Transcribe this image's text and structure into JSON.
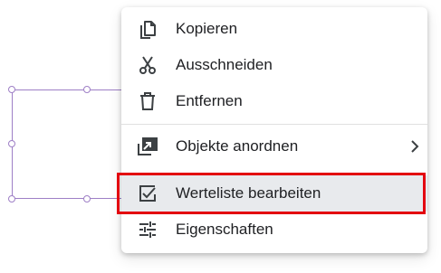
{
  "context_menu": {
    "items": [
      {
        "label": "Kopieren",
        "icon": "copy-icon"
      },
      {
        "label": "Ausschneiden",
        "icon": "scissors-icon"
      },
      {
        "label": "Entfernen",
        "icon": "trash-icon"
      },
      {
        "label": "Objekte anordnen",
        "icon": "arrange-icon",
        "has_submenu": true
      },
      {
        "label": "Werteliste bearbeiten",
        "icon": "checkbox-icon",
        "highlighted": true
      },
      {
        "label": "Eigenschaften",
        "icon": "sliders-icon"
      }
    ]
  },
  "colors": {
    "selection_border": "#9e7fc6",
    "highlight_frame": "#e3000f",
    "highlighted_row": "#e8eaed",
    "icon": "#3c4043",
    "text": "#202124"
  }
}
